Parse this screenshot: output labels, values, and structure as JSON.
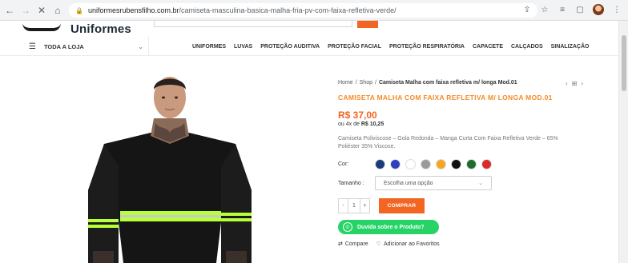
{
  "browser": {
    "url_domain": "uniformesrubensfilho.com.br",
    "url_path": "/camiseta-masculina-basica-malha-fria-pv-com-faixa-refletiva-verde/",
    "back_icon": "back-arrow",
    "forward_icon": "forward-arrow",
    "stop_icon": "close-x",
    "home_icon": "home"
  },
  "site": {
    "logo_text": "Uniformes"
  },
  "nav": {
    "all_store": "TODA A LOJA",
    "items": [
      "UNIFORMES",
      "LUVAS",
      "PROTEÇÃO AUDITIVA",
      "PROTEÇÃO FACIAL",
      "PROTEÇÃO RESPIRATÓRIA",
      "CAPACETE",
      "CALÇADOS",
      "SINALIZAÇÃO"
    ]
  },
  "product": {
    "breadcrumb": {
      "home": "Home",
      "sep1": "/",
      "shop": "Shop",
      "sep2": "/",
      "current": "Camiseta Malha com faixa refletiva m/ longa Mod.01"
    },
    "title": "CAMISETA MALHA COM FAIXA REFLETIVA M/ LONGA MOD.01",
    "price": "R$ 37,00",
    "installment_prefix": "ou 4x de ",
    "installment_value": "R$ 10,25",
    "description": "Camiseta Poliviscose – Gola Redonda – Manga Curta Com Faixa Refletiva Verde – 65% Poliéster 35% Viscose.",
    "color_label": "Cor:",
    "colors": [
      "#1a3c7a",
      "#2b3fbf",
      "#ffffff",
      "#9a9a9a",
      "#f5a623",
      "#111111",
      "#1e6b2b",
      "#d92b2b"
    ],
    "size_label": "Tamanho :",
    "size_placeholder": "Escolha uma opção",
    "qty_minus": "-",
    "qty_value": "1",
    "qty_plus": "+",
    "buy_label": "COMPRAR",
    "whatsapp_label": "Duvida sobre o Produto?",
    "compare_label": "Compare",
    "favorites_label": "Adicionar ao Favoritos"
  }
}
